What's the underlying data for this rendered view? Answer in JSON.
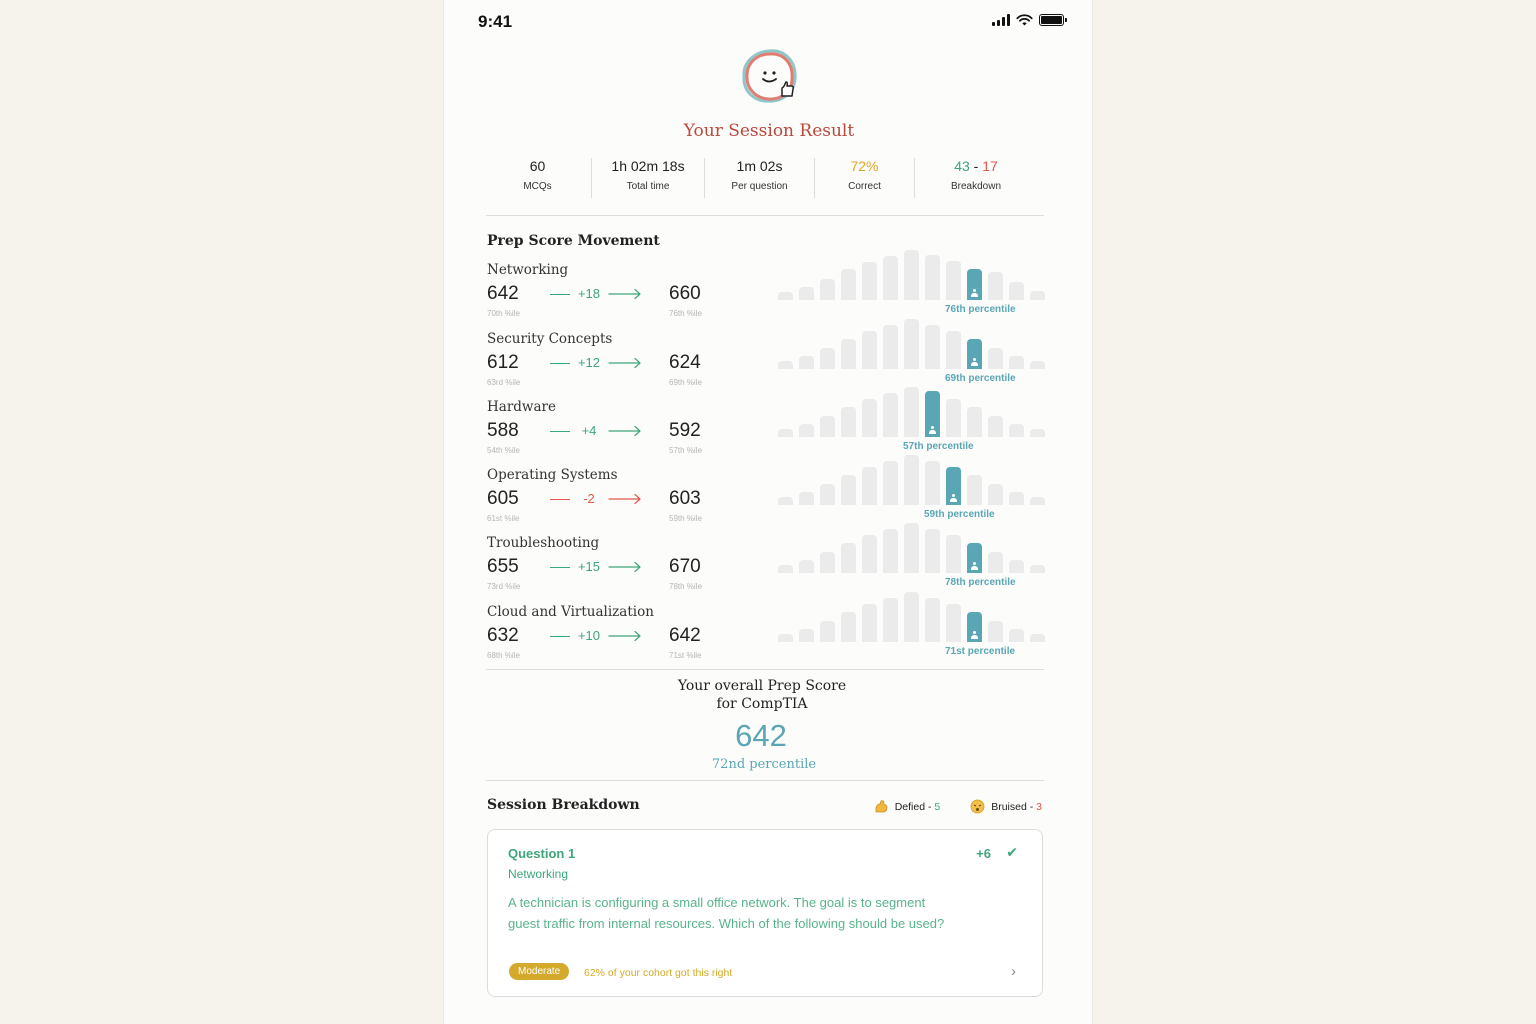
{
  "status_bar": {
    "time": "9:41"
  },
  "header": {
    "title": "Your Session Result"
  },
  "stats": [
    {
      "value": "60",
      "label": "MCQs"
    },
    {
      "value": "1h 02m 18s",
      "label": "Total time"
    },
    {
      "value": "1m 02s",
      "label": "Per question"
    },
    {
      "value": "72%",
      "label": "Correct"
    },
    {
      "value_correct": "43",
      "separator": " - ",
      "value_wrong": "17",
      "label": "Breakdown"
    }
  ],
  "prep_score": {
    "title": "Prep Score Movement",
    "topics": [
      {
        "name": "Networking",
        "before": "642",
        "before_pct": "70th %ile",
        "delta": "+18",
        "direction": "up",
        "after": "660",
        "after_pct": "76th %ile",
        "percentile": "76th percentile",
        "distribution": [
          0.15,
          0.25,
          0.42,
          0.62,
          0.75,
          0.88,
          1.0,
          0.9,
          0.78,
          0.62,
          0.55,
          0.36,
          0.18
        ],
        "highlight_index": 9
      },
      {
        "name": "Security Concepts",
        "before": "612",
        "before_pct": "63rd %ile",
        "delta": "+12",
        "direction": "up",
        "after": "624",
        "after_pct": "69th %ile",
        "percentile": "69th percentile",
        "distribution": [
          0.15,
          0.25,
          0.42,
          0.6,
          0.75,
          0.88,
          1.0,
          0.88,
          0.75,
          0.6,
          0.42,
          0.25,
          0.15
        ],
        "highlight_index": 9
      },
      {
        "name": "Hardware",
        "before": "588",
        "before_pct": "54th %ile",
        "delta": "+4",
        "direction": "up",
        "after": "592",
        "after_pct": "57th %ile",
        "percentile": "57th percentile",
        "distribution": [
          0.15,
          0.25,
          0.42,
          0.6,
          0.75,
          0.88,
          1.0,
          0.92,
          0.75,
          0.6,
          0.42,
          0.25,
          0.15
        ],
        "highlight_index": 7
      },
      {
        "name": "Operating Systems",
        "before": "605",
        "before_pct": "61st %ile",
        "delta": "-2",
        "direction": "down",
        "after": "603",
        "after_pct": "59th %ile",
        "percentile": "59th percentile",
        "distribution": [
          0.15,
          0.25,
          0.42,
          0.6,
          0.75,
          0.88,
          1.0,
          0.88,
          0.75,
          0.6,
          0.42,
          0.25,
          0.15
        ],
        "highlight_index": 8
      },
      {
        "name": "Troubleshooting",
        "before": "655",
        "before_pct": "73rd %ile",
        "delta": "+15",
        "direction": "up",
        "after": "670",
        "after_pct": "78th %ile",
        "percentile": "78th percentile",
        "distribution": [
          0.15,
          0.25,
          0.42,
          0.6,
          0.75,
          0.88,
          1.0,
          0.88,
          0.75,
          0.6,
          0.42,
          0.25,
          0.15
        ],
        "highlight_index": 9
      },
      {
        "name": "Cloud and Virtualization",
        "before": "632",
        "before_pct": "68th %ile",
        "delta": "+10",
        "direction": "up",
        "after": "642",
        "after_pct": "71st %ile",
        "percentile": "71st percentile",
        "distribution": [
          0.15,
          0.25,
          0.42,
          0.6,
          0.75,
          0.88,
          1.0,
          0.88,
          0.75,
          0.6,
          0.42,
          0.25,
          0.15
        ],
        "highlight_index": 9
      }
    ]
  },
  "overall": {
    "caption_line1": "Your overall Prep Score",
    "caption_line2": "for CompTIA",
    "score": "642",
    "percentile": "72nd percentile"
  },
  "breakdown": {
    "title": "Session Breakdown",
    "defied_label": "Defied - ",
    "defied_count": "5",
    "bruised_label": "Bruised - ",
    "bruised_count": "3"
  },
  "question": {
    "title": "Question 1",
    "topic": "Networking",
    "delta": "+6",
    "text": "A technician is configuring a small office network. The goal is to segment guest traffic from internal resources. Which of the following should be used?",
    "difficulty": "Moderate",
    "cohort": "62% of your cohort got this right"
  },
  "icons": {
    "logo": "smiley-thumbs-up-icon",
    "defied": "flexed-biceps-icon",
    "bruised": "bruised-face-icon",
    "correct": "check-icon",
    "open": "chevron-right-icon",
    "percentile_marker": "person-icon"
  },
  "colors": {
    "accent_teal": "#5aa6b5",
    "positive_green": "#3ea67a",
    "negative_red": "#e2574c",
    "warning_amber": "#e2a52b",
    "title_rust": "#b8493c"
  }
}
